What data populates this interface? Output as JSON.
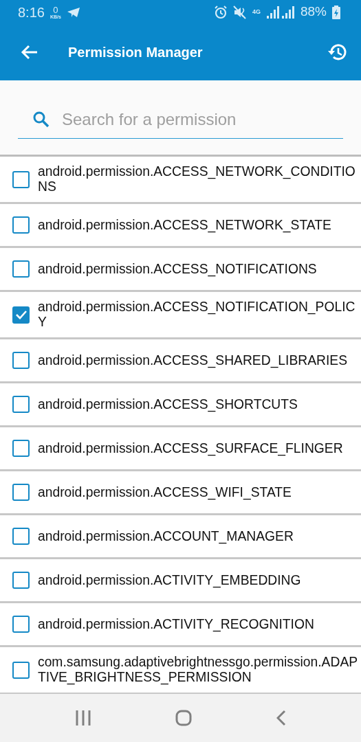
{
  "status_bar": {
    "time": "8:16",
    "speed_value": "0",
    "speed_unit": "KB/s",
    "network": "4G",
    "battery": "88%"
  },
  "app_bar": {
    "title": "Permission Manager"
  },
  "search": {
    "placeholder": "Search for a permission"
  },
  "permissions": [
    {
      "name": "android.permission.ACCESS_NETWORK_CONDITIONS",
      "checked": false
    },
    {
      "name": "android.permission.ACCESS_NETWORK_STATE",
      "checked": false
    },
    {
      "name": "android.permission.ACCESS_NOTIFICATIONS",
      "checked": false
    },
    {
      "name": "android.permission.ACCESS_NOTIFICATION_POLICY",
      "checked": true
    },
    {
      "name": "android.permission.ACCESS_SHARED_LIBRARIES",
      "checked": false
    },
    {
      "name": "android.permission.ACCESS_SHORTCUTS",
      "checked": false
    },
    {
      "name": "android.permission.ACCESS_SURFACE_FLINGER",
      "checked": false
    },
    {
      "name": "android.permission.ACCESS_WIFI_STATE",
      "checked": false
    },
    {
      "name": "android.permission.ACCOUNT_MANAGER",
      "checked": false
    },
    {
      "name": "android.permission.ACTIVITY_EMBEDDING",
      "checked": false
    },
    {
      "name": "android.permission.ACTIVITY_RECOGNITION",
      "checked": false
    },
    {
      "name": "com.samsung.adaptivebrightnessgo.permission.ADAPTIVE_BRIGHTNESS_PERMISSION",
      "checked": false
    }
  ]
}
